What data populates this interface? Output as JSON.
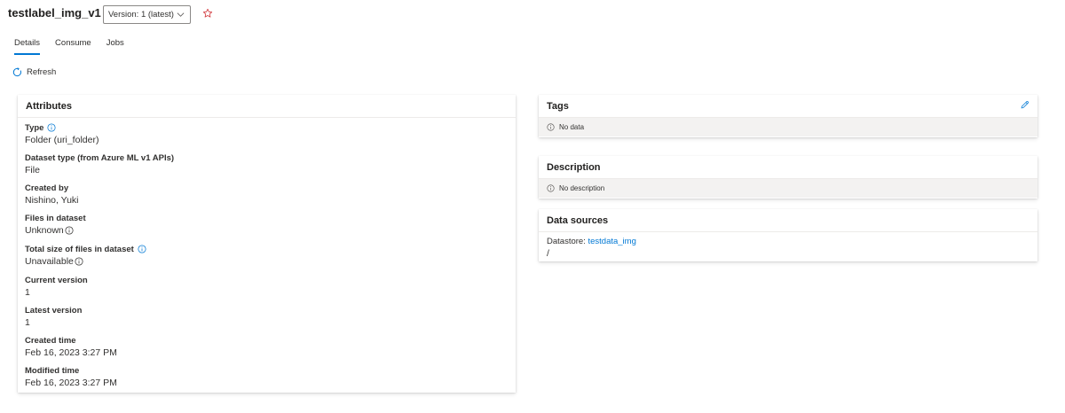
{
  "header": {
    "title": "testlabel_img_v1",
    "version_label": "Version: 1 (latest)"
  },
  "tabs": [
    {
      "label": "Details",
      "active": true
    },
    {
      "label": "Consume",
      "active": false
    },
    {
      "label": "Jobs",
      "active": false
    }
  ],
  "toolbar": {
    "refresh_label": "Refresh"
  },
  "attributes": {
    "heading": "Attributes",
    "items": [
      {
        "label": "Type",
        "value": "Folder (uri_folder)"
      },
      {
        "label": "Dataset type (from Azure ML v1 APIs)",
        "value": "File"
      },
      {
        "label": "Created by",
        "value": "Nishino, Yuki"
      },
      {
        "label": "Files in dataset",
        "value": "Unknown"
      },
      {
        "label": "Total size of files in dataset",
        "value": "Unavailable"
      },
      {
        "label": "Current version",
        "value": "1"
      },
      {
        "label": "Latest version",
        "value": "1"
      },
      {
        "label": "Created time",
        "value": "Feb 16, 2023 3:27 PM"
      },
      {
        "label": "Modified time",
        "value": "Feb 16, 2023 3:27 PM"
      }
    ]
  },
  "tags": {
    "heading": "Tags",
    "empty_text": "No data"
  },
  "description": {
    "heading": "Description",
    "empty_text": "No description"
  },
  "data_sources": {
    "heading": "Data sources",
    "datastore_label": "Datastore: ",
    "datastore_link": "testdata_img",
    "path": "/"
  },
  "colors": {
    "accent": "#0078d4",
    "star": "#d13438",
    "text": "#323130",
    "empty_row_bg": "#f3f2f1"
  },
  "icons": [
    "chevron-down-icon",
    "star-icon",
    "refresh-icon",
    "info-icon",
    "edit-icon"
  ]
}
